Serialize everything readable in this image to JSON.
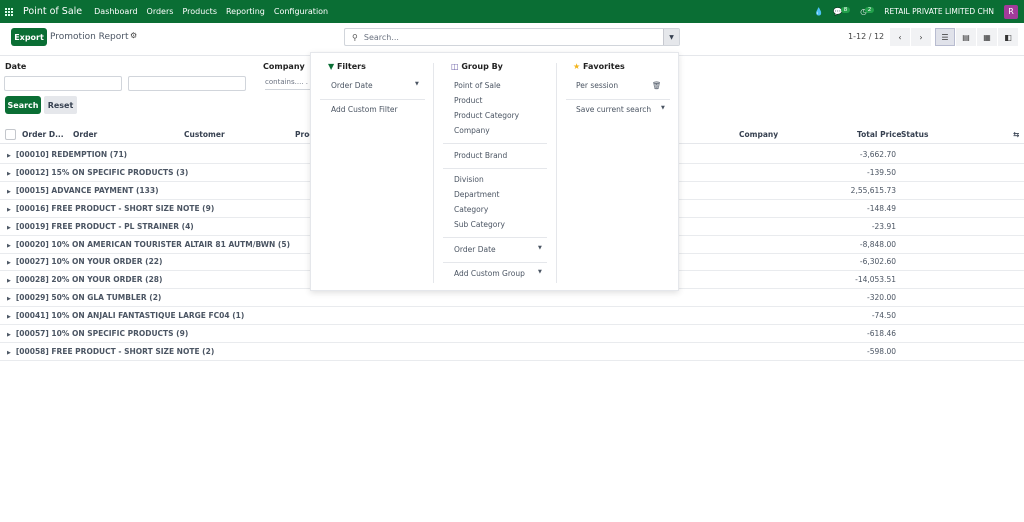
{
  "navbar": {
    "app": "Point of Sale",
    "menu": [
      "Dashboard",
      "Orders",
      "Products",
      "Reporting",
      "Configuration"
    ],
    "messages_count": "8",
    "activities_count": "2",
    "company": "RETAIL PRIVATE LIMITED CHN",
    "avatar": "R",
    "color": "#0a6e34"
  },
  "control": {
    "export": "Export",
    "title": "Promotion Report",
    "search_placeholder": "Search...",
    "pager": "1-12 / 12"
  },
  "filters": {
    "date_label": "Date",
    "company_label": "Company",
    "company_placeholder": "contains.... .",
    "search": "Search",
    "reset": "Reset"
  },
  "table": {
    "headers": [
      "Order D...",
      "Order",
      "Customer",
      "Proc",
      "Company",
      "Total Price",
      "Status"
    ],
    "rows": [
      {
        "label": "[00010] REDEMPTION (71)",
        "total": "-3,662.70"
      },
      {
        "label": "[00012] 15% ON SPECIFIC PRODUCTS (3)",
        "total": "-139.50"
      },
      {
        "label": "[00015] ADVANCE PAYMENT (133)",
        "total": "2,55,615.73"
      },
      {
        "label": "[00016] FREE PRODUCT - SHORT SIZE NOTE (9)",
        "total": "-148.49"
      },
      {
        "label": "[00019] FREE PRODUCT - PL STRAINER (4)",
        "total": "-23.91"
      },
      {
        "label": "[00020] 10% ON AMERICAN TOURISTER ALTAIR 81 AUTM/BWN (5)",
        "total": "-8,848.00"
      },
      {
        "label": "[00027] 10% ON YOUR ORDER (22)",
        "total": "-6,302.60"
      },
      {
        "label": "[00028] 20% ON YOUR ORDER (28)",
        "total": "-14,053.51"
      },
      {
        "label": "[00029] 50% ON GLA TUMBLER (2)",
        "total": "-320.00"
      },
      {
        "label": "[00041] 10% ON ANJALI FANTASTIQUE LARGE FC04 (1)",
        "total": "-74.50"
      },
      {
        "label": "[00057] 10% ON SPECIFIC PRODUCTS (9)",
        "total": "-618.46"
      },
      {
        "label": "[00058] FREE PRODUCT - SHORT SIZE NOTE (2)",
        "total": "-598.00"
      }
    ]
  },
  "dropdown": {
    "filters": {
      "title": "Filters",
      "items": [
        "Order Date",
        "Add Custom Filter"
      ]
    },
    "groupby": {
      "title": "Group By",
      "items": [
        "Point of Sale",
        "Product",
        "Product Category",
        "Company",
        "Product Brand",
        "Division",
        "Department",
        "Category",
        "Sub Category",
        "Order Date",
        "Add Custom Group"
      ]
    },
    "favorites": {
      "title": "Favorites",
      "items": [
        "Per session",
        "Save current search"
      ]
    }
  }
}
